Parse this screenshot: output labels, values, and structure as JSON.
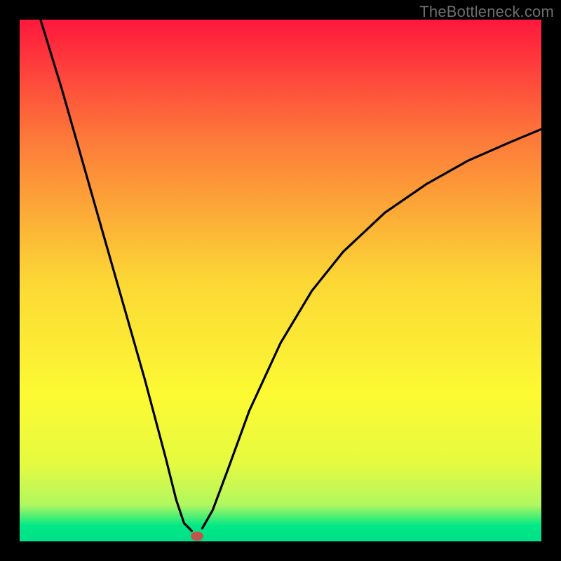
{
  "watermark": "TheBottleneck.com",
  "chart_data": {
    "type": "line",
    "title": "",
    "xlabel": "",
    "ylabel": "",
    "xlim": [
      0,
      100
    ],
    "ylim": [
      0,
      100
    ],
    "note": "Values read off the plot by pixel position; axes are unlabeled so the domain is normalized 0-100 on each axis.",
    "curve_left": {
      "name": "left-branch",
      "x": [
        4.0,
        8.0,
        12.0,
        16.0,
        20.0,
        24.0,
        28.0,
        30.0,
        31.5,
        33.0
      ],
      "y": [
        100.0,
        87.0,
        73.0,
        59.0,
        45.0,
        31.0,
        16.0,
        8.0,
        3.5,
        2.0
      ]
    },
    "curve_right": {
      "name": "right-branch",
      "x": [
        35.0,
        37.0,
        40.0,
        44.0,
        50.0,
        56.0,
        62.0,
        70.0,
        78.0,
        86.0,
        94.0,
        100.0
      ],
      "y": [
        2.5,
        6.0,
        14.0,
        25.0,
        38.0,
        48.0,
        55.5,
        63.0,
        68.5,
        73.0,
        76.5,
        79.0
      ]
    },
    "marker": {
      "name": "minimum-point",
      "x": 34.0,
      "y": 1.0,
      "color": "#c1554b"
    },
    "background_gradient": {
      "top": "#fe183d",
      "upper_mid": "#fd7a3a",
      "mid": "#fcd735",
      "lower_mid_a": "#fcfa33",
      "lower_mid_b": "#e6fa40",
      "green_band_top": "#b1f760",
      "green_band_bot": "#00e886",
      "bottom": "#00e089"
    }
  }
}
